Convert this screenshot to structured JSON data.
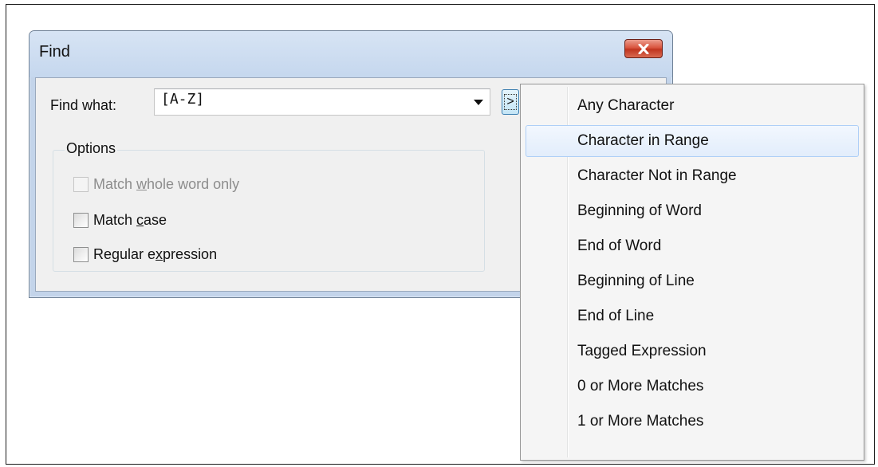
{
  "dialog": {
    "title": "Find",
    "close_icon": "close-icon",
    "close_color": "#c7432f",
    "find_what": {
      "label": "Find what:",
      "value": "[A-Z]"
    },
    "regex_button_label": ">",
    "options": {
      "legend": "Options",
      "match_whole_word": {
        "pre": "Match ",
        "access": "w",
        "post": "hole word only",
        "enabled": false,
        "checked": false
      },
      "match_case": {
        "pre": "Match ",
        "access": "c",
        "post": "ase",
        "enabled": true,
        "checked": false
      },
      "regular_expression": {
        "pre": "Regular e",
        "access": "x",
        "post": "pression",
        "enabled": true,
        "checked": false
      }
    }
  },
  "menu": {
    "highlighted_index": 1,
    "items": [
      "Any Character",
      "Character in Range",
      "Character Not in Range",
      "Beginning of Word",
      "End of Word",
      "Beginning of Line",
      "End of Line",
      "Tagged Expression",
      "0 or More Matches",
      "1 or More Matches"
    ]
  }
}
